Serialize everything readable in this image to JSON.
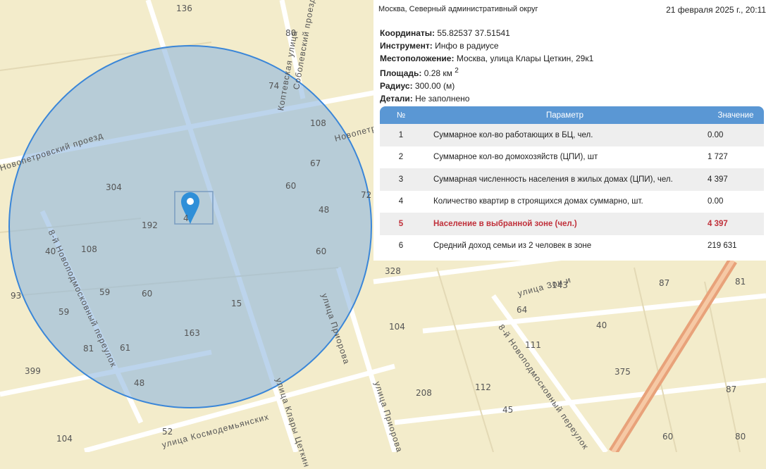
{
  "panel": {
    "district": "Москва, Северный административный округ",
    "datetime": "21 февраля 2025 г., 20:11",
    "fields": [
      {
        "label": "Координаты:",
        "value": "55.82537 37.51541"
      },
      {
        "label": "Инструмент:",
        "value": "Инфо в радиусе"
      },
      {
        "label": "Местоположение:",
        "value": "Москва, улица Клары Цеткин, 29к1"
      },
      {
        "label": "Площадь:",
        "value": "0.28 км",
        "sup": "2"
      },
      {
        "label": "Радиус:",
        "value": "300.00 (м)"
      },
      {
        "label": "Детали:",
        "value": "Не заполнено"
      }
    ],
    "table": {
      "headers": [
        "№",
        "Параметр",
        "Значение"
      ],
      "rows": [
        {
          "n": "1",
          "param": "Суммарное кол-во работающих в БЦ, чел.",
          "value": "0.00"
        },
        {
          "n": "2",
          "param": "Суммарное кол-во домохозяйств (ЦПИ), шт",
          "value": "1 727"
        },
        {
          "n": "3",
          "param": "Суммарная численность населения в жилых домах (ЦПИ), чел.",
          "value": "4 397"
        },
        {
          "n": "4",
          "param": "Количество квартир в строящихся домах суммарно, шт.",
          "value": "0.00"
        },
        {
          "n": "5",
          "param": "Население в выбранной зоне (чел.)",
          "value": "4 397"
        },
        {
          "n": "6",
          "param": "Средний доход семьи из 2 человек в зоне",
          "value": "219 631"
        }
      ]
    }
  },
  "map": {
    "colors": {
      "land": "#f3eccb",
      "road": "#ffffff",
      "circle_fill": "#8fb8e0",
      "circle_stroke": "#3a86d8",
      "marker": "#2f8fd8",
      "highway": "#e8a27a"
    },
    "labels": [
      "136",
      "80",
      "74",
      "108",
      "67",
      "60",
      "48",
      "60",
      "72",
      "304",
      "192",
      "108",
      "40",
      "59",
      "60",
      "15",
      "59",
      "163",
      "81",
      "61",
      "48",
      "399",
      "93",
      "104",
      "52",
      "328",
      "143",
      "87",
      "81",
      "64",
      "40",
      "104",
      "111",
      "375",
      "112",
      "208",
      "45",
      "87",
      "60",
      "80",
      "4"
    ],
    "streets": [
      "Новопетровский проезд",
      "Коптевская улица",
      "Соболевский проезд",
      "Новопетр",
      "8-й Новоподмосковный переулок",
      "улица Приорова",
      "улица Зои и",
      "улица Клары Цеткин",
      "улица Космодемьянских",
      "8-й Новоподмосковный переулок",
      "улица Приорова"
    ]
  }
}
